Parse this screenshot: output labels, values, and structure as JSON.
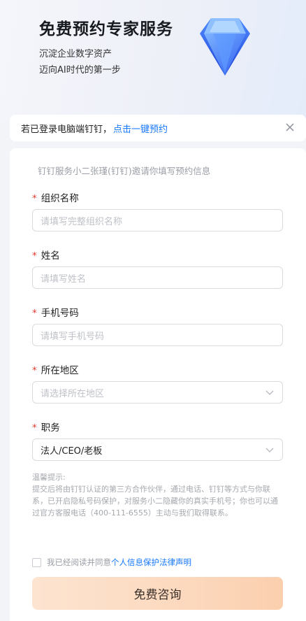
{
  "hero": {
    "title": "免费预约专家服务",
    "subtitle_line1": "沉淀企业数字资产",
    "subtitle_line2": "迈向AI时代的第一步",
    "icon": "diamond-icon"
  },
  "notice": {
    "text": "若已登录电脑端钉钉，",
    "link": "点击一键预约",
    "close_icon": "close-icon"
  },
  "form": {
    "intro": "钉钉服务小二张瑾(钉钉)邀请你填写预约信息",
    "required_mark": "*",
    "fields": [
      {
        "label": "组织名称",
        "placeholder": "请填写完整组织名称",
        "value": ""
      },
      {
        "label": "姓名",
        "placeholder": "请填写姓名",
        "value": ""
      },
      {
        "label": "手机号码",
        "placeholder": "请填写手机号码",
        "value": ""
      },
      {
        "label": "所在地区",
        "placeholder": "请选择所在地区",
        "value": ""
      },
      {
        "label": "职务",
        "placeholder": "",
        "value": "法人/CEO/老板"
      }
    ],
    "tips": {
      "title": "温馨提示:",
      "body": "提交后将由钉钉认证的第三方合作伙伴，通过电话、钉钉等方式与你联系，已开启隐私号码保护，对服务小二隐藏你的真实手机号；你也可以通过官方客服电话（400-111-6555）主动与我们取得联系。"
    },
    "agreement": {
      "text": "我已经阅读并同意",
      "link": "个人信息保护法律声明",
      "checked": false
    },
    "submit_label": "免费咨询"
  },
  "colors": {
    "accent": "#1677ff",
    "required": "#e23b2e",
    "button_gradient_start": "#fde4d0",
    "button_gradient_end": "#fbcfae"
  }
}
